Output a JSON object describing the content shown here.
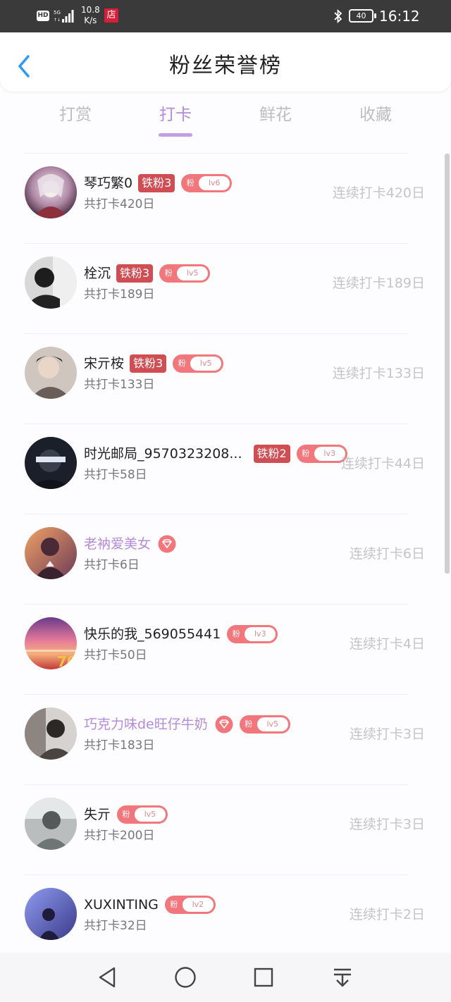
{
  "status_bar": {
    "hd": "HD",
    "speed_value": "10.8",
    "speed_unit": "K/s",
    "store_icon_text": "店",
    "battery": "40",
    "time": "16:12"
  },
  "header": {
    "title": "粉丝荣誉榜"
  },
  "tabs": [
    {
      "label": "打赏",
      "active": false
    },
    {
      "label": "打卡",
      "active": true
    },
    {
      "label": "鲜花",
      "active": false
    },
    {
      "label": "收藏",
      "active": false
    }
  ],
  "fan_label": "粉",
  "rows": [
    {
      "name": "琴巧繁0",
      "purple": false,
      "iron": "铁粉3",
      "diamond": false,
      "level": "lv6",
      "total": "共打卡420日",
      "streak": "连续打卡420日"
    },
    {
      "name": "栓沉",
      "purple": false,
      "iron": "铁粉3",
      "diamond": false,
      "level": "lv5",
      "total": "共打卡189日",
      "streak": "连续打卡189日"
    },
    {
      "name": "宋亓桉",
      "purple": false,
      "iron": "铁粉3",
      "diamond": false,
      "level": "lv5",
      "total": "共打卡133日",
      "streak": "连续打卡133日"
    },
    {
      "name": "时光邮局_9570323208...",
      "purple": false,
      "iron": "铁粉2",
      "diamond": false,
      "level": "lv3",
      "total": "共打卡58日",
      "streak": "连续打卡44日"
    },
    {
      "name": "老衲爱美女",
      "purple": true,
      "iron": "",
      "diamond": true,
      "level": "",
      "total": "共打卡6日",
      "streak": "连续打卡6日"
    },
    {
      "name": "快乐的我_569055441",
      "purple": false,
      "iron": "",
      "diamond": false,
      "level": "lv3",
      "total": "共打卡50日",
      "streak": "连续打卡4日"
    },
    {
      "name": "巧克力味de旺仔牛奶",
      "purple": true,
      "iron": "",
      "diamond": true,
      "level": "lv5",
      "total": "共打卡183日",
      "streak": "连续打卡3日"
    },
    {
      "name": "失亓",
      "purple": false,
      "iron": "",
      "diamond": false,
      "level": "lv5",
      "total": "共打卡200日",
      "streak": "连续打卡3日"
    },
    {
      "name": "XUXINTING",
      "purple": false,
      "iron": "",
      "diamond": false,
      "level": "lv2",
      "total": "共打卡32日",
      "streak": "连续打卡2日"
    }
  ],
  "colors": {
    "accent_purple": "#b48bd8",
    "iron_badge": "#cf4e54",
    "fan_pill": "#f2777c"
  }
}
